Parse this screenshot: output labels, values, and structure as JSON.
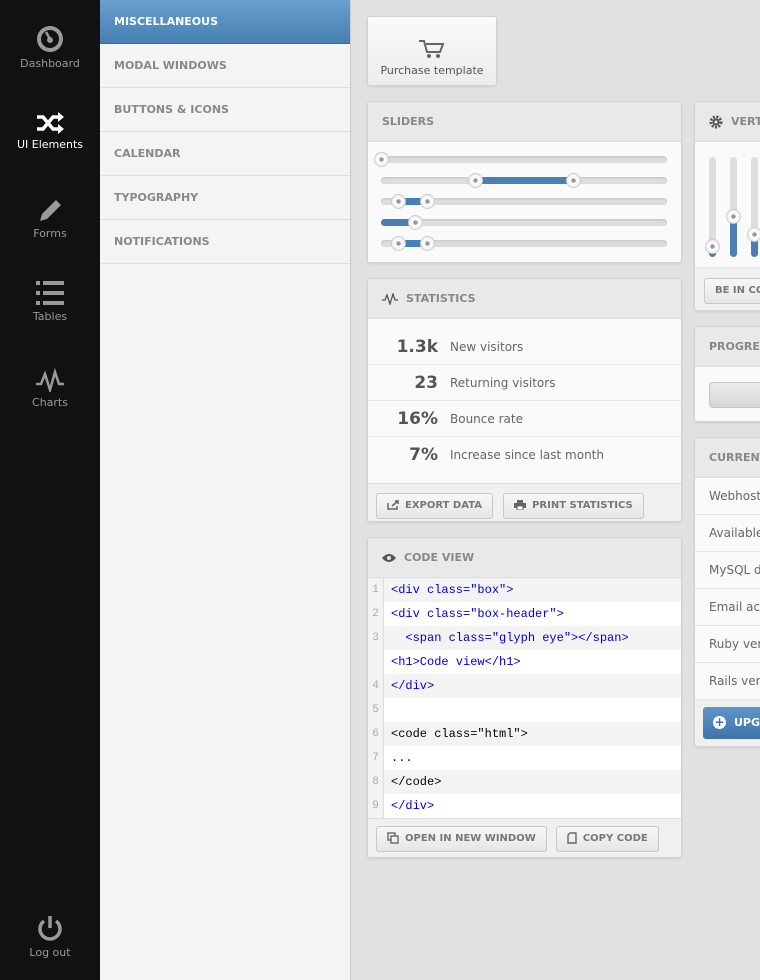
{
  "nav": [
    {
      "label": "Dashboard",
      "icon": "dashboard-gauge-icon"
    },
    {
      "label": "UI Elements",
      "icon": "shuffle-icon",
      "active": true
    },
    {
      "label": "Forms",
      "icon": "pencil-icon"
    },
    {
      "label": "Tables",
      "icon": "list-icon"
    },
    {
      "label": "Charts",
      "icon": "pulse-icon"
    },
    {
      "label": "Log out",
      "icon": "power-icon"
    }
  ],
  "submenu": [
    "MISCELLANEOUS",
    "MODAL WINDOWS",
    "BUTTONS & ICONS",
    "CALENDAR",
    "TYPOGRAPHY",
    "NOTIFICATIONS"
  ],
  "purchase": {
    "label": "Purchase template",
    "icon": "cart-icon"
  },
  "sliders": {
    "title": "SLIDERS",
    "items": [
      {
        "type": "single",
        "value": 0
      },
      {
        "type": "range",
        "values": [
          33,
          67
        ]
      },
      {
        "type": "range",
        "values": [
          6,
          16
        ]
      },
      {
        "type": "min",
        "value": 12
      },
      {
        "type": "range",
        "values": [
          6,
          16
        ]
      }
    ]
  },
  "vertical": {
    "title": "VERT",
    "button": "BE IN CO",
    "values": [
      10,
      40,
      22
    ]
  },
  "progress": {
    "title": "PROGRES"
  },
  "current": {
    "title": "CURRENT",
    "rows": [
      "Webhosti",
      "Available",
      "MySQL da",
      "Email acc",
      "Ruby vers",
      "Rails vers"
    ],
    "button": "UPG"
  },
  "statistics": {
    "title": "STATISTICS",
    "rows": [
      {
        "value": "1.3k",
        "label": "New visitors"
      },
      {
        "value": "23",
        "label": "Returning visitors"
      },
      {
        "value": "16%",
        "label": "Bounce rate"
      },
      {
        "value": "7%",
        "label": "Increase since last month"
      }
    ],
    "export": "EXPORT DATA",
    "print": "PRINT STATISTICS"
  },
  "code": {
    "title": "CODE VIEW",
    "lines": [
      {
        "n": "1",
        "text": "<div class=\"box\">",
        "color": "blue"
      },
      {
        "n": "2",
        "text": "<div class=\"box-header\">",
        "color": "blue"
      },
      {
        "n": "3",
        "text": "  <span class=\"glyph eye\"></span>",
        "color": "blue"
      },
      {
        "n": "",
        "text": "<h1>Code view</h1>",
        "color": "blue"
      },
      {
        "n": "4",
        "text": "</div>",
        "color": "blue"
      },
      {
        "n": "5",
        "text": "",
        "color": "black"
      },
      {
        "n": "6",
        "text": "<code class=\"html\">",
        "color": "black"
      },
      {
        "n": "7",
        "text": "...",
        "color": "black"
      },
      {
        "n": "8",
        "text": "</code>",
        "color": "black"
      },
      {
        "n": "9",
        "text": "</div>",
        "color": "blue"
      }
    ],
    "open": "OPEN IN NEW WINDOW",
    "copy": "COPY CODE"
  },
  "colors": {
    "accent": "#4a7fb5",
    "sidebar": "#111111"
  }
}
